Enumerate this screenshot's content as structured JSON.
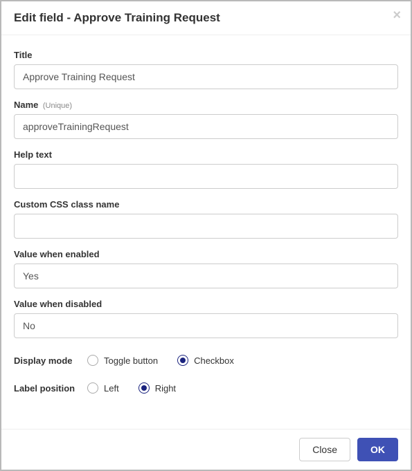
{
  "header": {
    "title": "Edit field - Approve Training Request"
  },
  "fields": {
    "title": {
      "label": "Title",
      "value": "Approve Training Request"
    },
    "name": {
      "label": "Name",
      "sublabel": "(Unique)",
      "value": "approveTrainingRequest"
    },
    "help_text": {
      "label": "Help text",
      "value": ""
    },
    "css_class": {
      "label": "Custom CSS class name",
      "value": ""
    },
    "value_enabled": {
      "label": "Value when enabled",
      "value": "Yes"
    },
    "value_disabled": {
      "label": "Value when disabled",
      "value": "No"
    }
  },
  "display_mode": {
    "label": "Display mode",
    "options": {
      "toggle": "Toggle button",
      "checkbox": "Checkbox"
    },
    "selected": "checkbox"
  },
  "label_position": {
    "label": "Label position",
    "options": {
      "left": "Left",
      "right": "Right"
    },
    "selected": "right"
  },
  "footer": {
    "close": "Close",
    "ok": "OK"
  }
}
